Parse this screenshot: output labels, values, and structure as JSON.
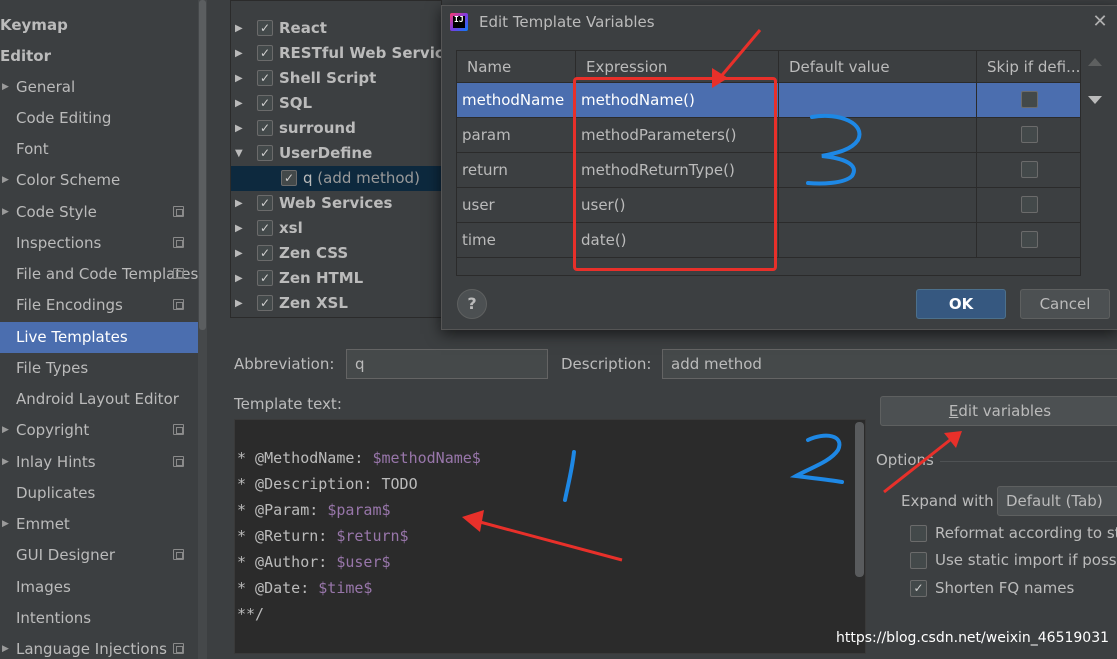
{
  "sidebar": {
    "items": [
      {
        "label": "Keymap",
        "kind": "top"
      },
      {
        "label": "Editor",
        "kind": "top"
      },
      {
        "label": "General",
        "kind": "expandable"
      },
      {
        "label": "Code Editing",
        "kind": "plain"
      },
      {
        "label": "Font",
        "kind": "plain"
      },
      {
        "label": "Color Scheme",
        "kind": "expandable"
      },
      {
        "label": "Code Style",
        "kind": "expandable",
        "copy": true
      },
      {
        "label": "Inspections",
        "kind": "plain",
        "copy": true
      },
      {
        "label": "File and Code Templates",
        "kind": "plain",
        "copy": true
      },
      {
        "label": "File Encodings",
        "kind": "plain",
        "copy": true
      },
      {
        "label": "Live Templates",
        "kind": "plain",
        "selected": true
      },
      {
        "label": "File Types",
        "kind": "plain"
      },
      {
        "label": "Android Layout Editor",
        "kind": "plain"
      },
      {
        "label": "Copyright",
        "kind": "expandable",
        "copy": true
      },
      {
        "label": "Inlay Hints",
        "kind": "expandable",
        "copy": true
      },
      {
        "label": "Duplicates",
        "kind": "plain"
      },
      {
        "label": "Emmet",
        "kind": "expandable"
      },
      {
        "label": "GUI Designer",
        "kind": "plain",
        "copy": true
      },
      {
        "label": "Images",
        "kind": "plain"
      },
      {
        "label": "Intentions",
        "kind": "plain"
      },
      {
        "label": "Language Injections",
        "kind": "expandable",
        "copy": true
      }
    ]
  },
  "tree": {
    "groups": [
      {
        "label": "React",
        "expanded": false,
        "checked": true
      },
      {
        "label": "RESTful Web Services",
        "expanded": false,
        "checked": true
      },
      {
        "label": "Shell Script",
        "expanded": false,
        "checked": true
      },
      {
        "label": "SQL",
        "expanded": false,
        "checked": true
      },
      {
        "label": "surround",
        "expanded": false,
        "checked": true
      },
      {
        "label": "UserDefine",
        "expanded": true,
        "checked": true
      },
      {
        "label": "q",
        "desc": "(add method)",
        "child": true,
        "checked": true
      },
      {
        "label": "Web Services",
        "expanded": false,
        "checked": true
      },
      {
        "label": "xsl",
        "expanded": false,
        "checked": true
      },
      {
        "label": "Zen CSS",
        "expanded": false,
        "checked": true
      },
      {
        "label": "Zen HTML",
        "expanded": false,
        "checked": true
      },
      {
        "label": "Zen XSL",
        "expanded": false,
        "checked": true
      }
    ]
  },
  "abbreviation": {
    "label": "Abbreviation:",
    "value": "q"
  },
  "description": {
    "label": "Description:",
    "value": "add method"
  },
  "template_text": {
    "label": "Template text:",
    "lines": [
      [
        {
          "t": "* @MethodName: ",
          "v": false
        },
        {
          "t": "$methodName$",
          "v": true
        }
      ],
      [
        {
          "t": "* @Description: TODO",
          "v": false
        }
      ],
      [
        {
          "t": "* @Param: ",
          "v": false
        },
        {
          "t": "$param$",
          "v": true
        }
      ],
      [
        {
          "t": "* @Return: ",
          "v": false
        },
        {
          "t": "$return$",
          "v": true
        }
      ],
      [
        {
          "t": "* @Author: ",
          "v": false
        },
        {
          "t": "$user$",
          "v": true
        }
      ],
      [
        {
          "t": "* @Date: ",
          "v": false
        },
        {
          "t": "$time$",
          "v": true
        }
      ],
      [
        {
          "t": "**/",
          "v": false
        }
      ]
    ]
  },
  "edit_variables_button": "Edit variables",
  "options": {
    "title": "Options",
    "expand_with_label": "Expand with",
    "expand_with_value": "Default (Tab)",
    "reformat": {
      "label": "Reformat according to st",
      "checked": false
    },
    "static_import": {
      "label": "Use static import if possi",
      "checked": false
    },
    "shorten_fq": {
      "label": "Shorten FQ names",
      "checked": true
    }
  },
  "dialog": {
    "title": "Edit Template Variables",
    "columns": [
      "Name",
      "Expression",
      "Default value",
      "Skip if defi..."
    ],
    "rows": [
      {
        "name": "methodName",
        "expression": "methodName()",
        "default": "",
        "skip": false,
        "selected": true
      },
      {
        "name": "param",
        "expression": "methodParameters()",
        "default": "",
        "skip": false
      },
      {
        "name": "return",
        "expression": "methodReturnType()",
        "default": "",
        "skip": false
      },
      {
        "name": "user",
        "expression": "user()",
        "default": "",
        "skip": false
      },
      {
        "name": "time",
        "expression": "date()",
        "default": "",
        "skip": false
      }
    ],
    "ok": "OK",
    "cancel": "Cancel",
    "help": "?"
  },
  "watermark": "https://blog.csdn.net/weixin_46519031",
  "colors": {
    "background": "#3c3f41",
    "selection": "#4b6eaf",
    "editor_bg": "#2b2b2b",
    "template_var": "#9876aa",
    "annotation_red": "#e8302a",
    "annotation_blue": "#1e88e5"
  }
}
